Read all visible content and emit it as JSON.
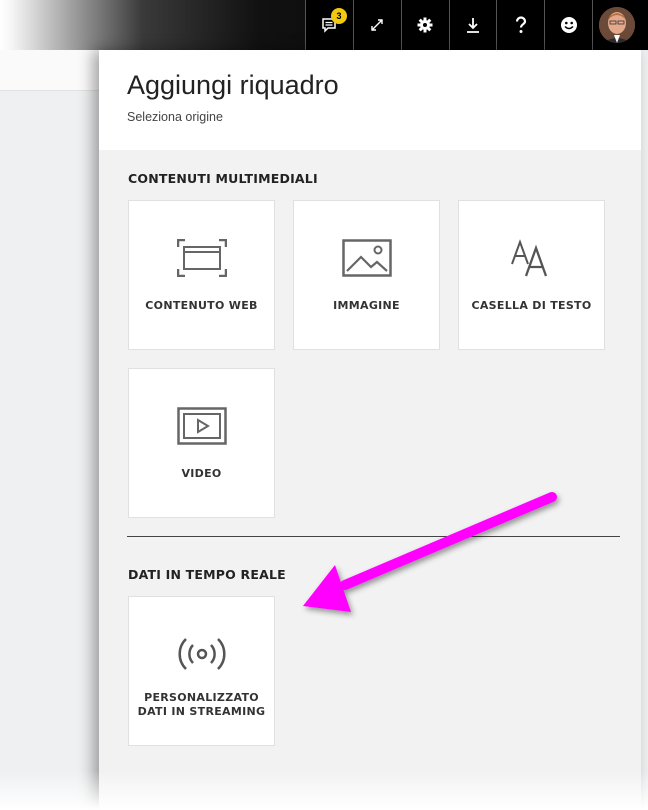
{
  "topbar": {
    "notifications_count": "3",
    "icons": [
      "notifications-icon",
      "expand-icon",
      "settings-icon",
      "download-icon",
      "help-icon",
      "feedback-icon",
      "avatar"
    ]
  },
  "panel": {
    "title": "Aggiungi riquadro",
    "subtitle": "Seleziona origine"
  },
  "sections": {
    "media": {
      "heading": "CONTENUTI MULTIMEDIALI",
      "tiles": [
        {
          "label": "CONTENUTO WEB",
          "icon": "web-content-icon"
        },
        {
          "label": "IMMAGINE",
          "icon": "image-icon"
        },
        {
          "label": "CASELLA DI TESTO",
          "icon": "text-box-icon"
        },
        {
          "label": "VIDEO",
          "icon": "video-icon"
        }
      ]
    },
    "realtime": {
      "heading": "DATI IN TEMPO REALE",
      "tiles": [
        {
          "label_line1": "PERSONALIZZATO",
          "label_line2": "DATI IN STREAMING",
          "icon": "streaming-icon"
        }
      ]
    }
  },
  "colors": {
    "accent_badge": "#f2c811",
    "arrow": "#ff00ff",
    "panel_bg": "#f2f2f2"
  }
}
